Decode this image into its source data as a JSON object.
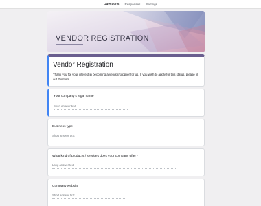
{
  "tabs": [
    {
      "label": "Questions",
      "active": true
    },
    {
      "label": "Responses",
      "active": false
    },
    {
      "label": "Settings",
      "active": false
    }
  ],
  "banner": {
    "title": "VENDOR REGISTRATION"
  },
  "form": {
    "title": "Vendor Registration",
    "description": "Thank you for your interest in becoming a vendor/supplier for us. If you wish to apply for this status, please fill out this form."
  },
  "questions": [
    {
      "label": "Your company's legal name",
      "answer_placeholder": "Short answer text",
      "type": "short",
      "selected": true
    },
    {
      "label": "Business type",
      "answer_placeholder": "Short answer text",
      "type": "short",
      "selected": false
    },
    {
      "label": "What kind of products / services does your company offer?",
      "answer_placeholder": "Long answer text",
      "type": "long",
      "selected": false
    },
    {
      "label": "Company website",
      "answer_placeholder": "Short answer text",
      "type": "short",
      "selected": false
    }
  ],
  "colors": {
    "accent": "#673ab7",
    "selected_border": "#4285f4",
    "background": "#f0eff1"
  }
}
